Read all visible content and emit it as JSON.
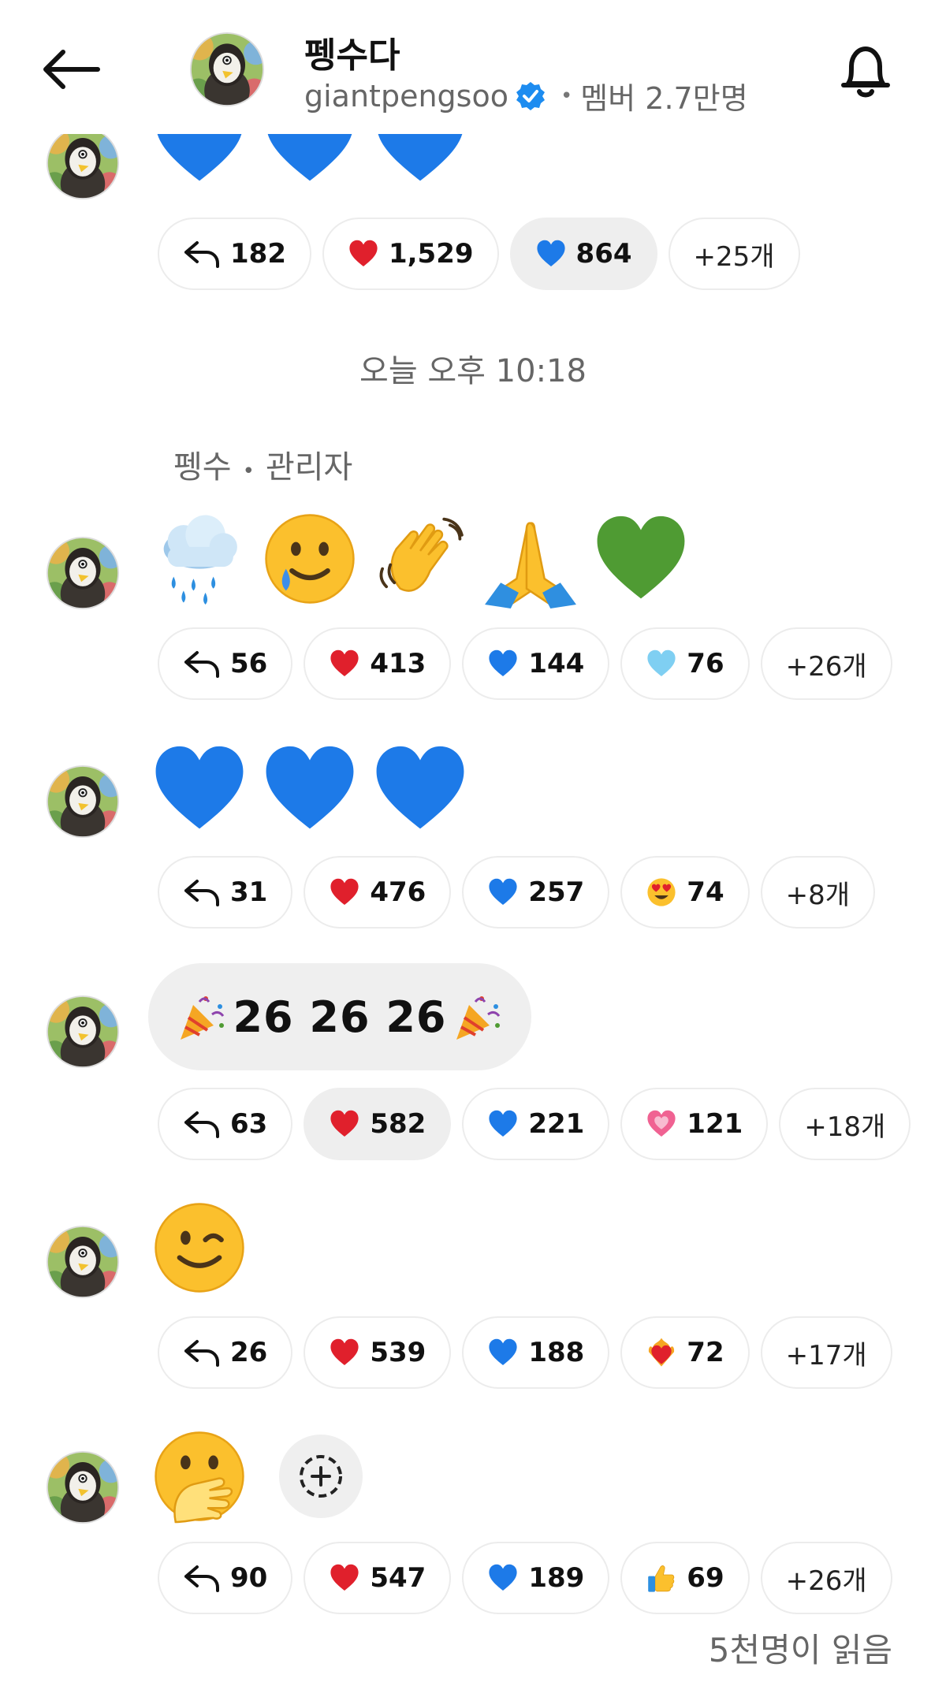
{
  "header": {
    "title": "펭수다",
    "handle": "giantpengsoo",
    "member_text": "멤버 2.7만명"
  },
  "timestamp": "오늘 오후 10:18",
  "sender": {
    "name": "펭수",
    "role": "관리자"
  },
  "messages": [
    {
      "emojis": [
        "blue-heart",
        "blue-heart",
        "blue-heart"
      ],
      "reactions": [
        {
          "icon": "reply",
          "count": "182"
        },
        {
          "icon": "red-heart",
          "count": "1,529"
        },
        {
          "icon": "blue-heart",
          "count": "864",
          "active": true
        },
        {
          "more": "+25개"
        }
      ]
    },
    {
      "emojis": [
        "cloud-rain",
        "smiling-tear",
        "waving-hand",
        "folded-hands",
        "green-heart"
      ],
      "reactions": [
        {
          "icon": "reply",
          "count": "56"
        },
        {
          "icon": "red-heart",
          "count": "413"
        },
        {
          "icon": "blue-heart",
          "count": "144"
        },
        {
          "icon": "light-blue-heart",
          "count": "76"
        },
        {
          "more": "+26개"
        }
      ]
    },
    {
      "emojis": [
        "blue-heart",
        "blue-heart",
        "blue-heart"
      ],
      "reactions": [
        {
          "icon": "reply",
          "count": "31"
        },
        {
          "icon": "red-heart",
          "count": "476"
        },
        {
          "icon": "blue-heart",
          "count": "257"
        },
        {
          "icon": "heart-eyes",
          "count": "74"
        },
        {
          "more": "+8개"
        }
      ]
    },
    {
      "text": "26  26  26",
      "reactions": [
        {
          "icon": "reply",
          "count": "63"
        },
        {
          "icon": "red-heart",
          "count": "582",
          "active": true
        },
        {
          "icon": "blue-heart",
          "count": "221"
        },
        {
          "icon": "pink-heart",
          "count": "121"
        },
        {
          "more": "+18개"
        }
      ]
    },
    {
      "emojis": [
        "winking-face"
      ],
      "reactions": [
        {
          "icon": "reply",
          "count": "26"
        },
        {
          "icon": "red-heart",
          "count": "539"
        },
        {
          "icon": "blue-heart",
          "count": "188"
        },
        {
          "icon": "heart-on-fire",
          "count": "72"
        },
        {
          "more": "+17개"
        }
      ]
    },
    {
      "emojis": [
        "hand-over-mouth"
      ],
      "reactions": [
        {
          "icon": "reply",
          "count": "90"
        },
        {
          "icon": "red-heart",
          "count": "547"
        },
        {
          "icon": "blue-heart",
          "count": "189"
        },
        {
          "icon": "thumbs-up",
          "count": "69"
        },
        {
          "more": "+26개"
        }
      ]
    }
  ],
  "read_count": "5천명이 읽음"
}
